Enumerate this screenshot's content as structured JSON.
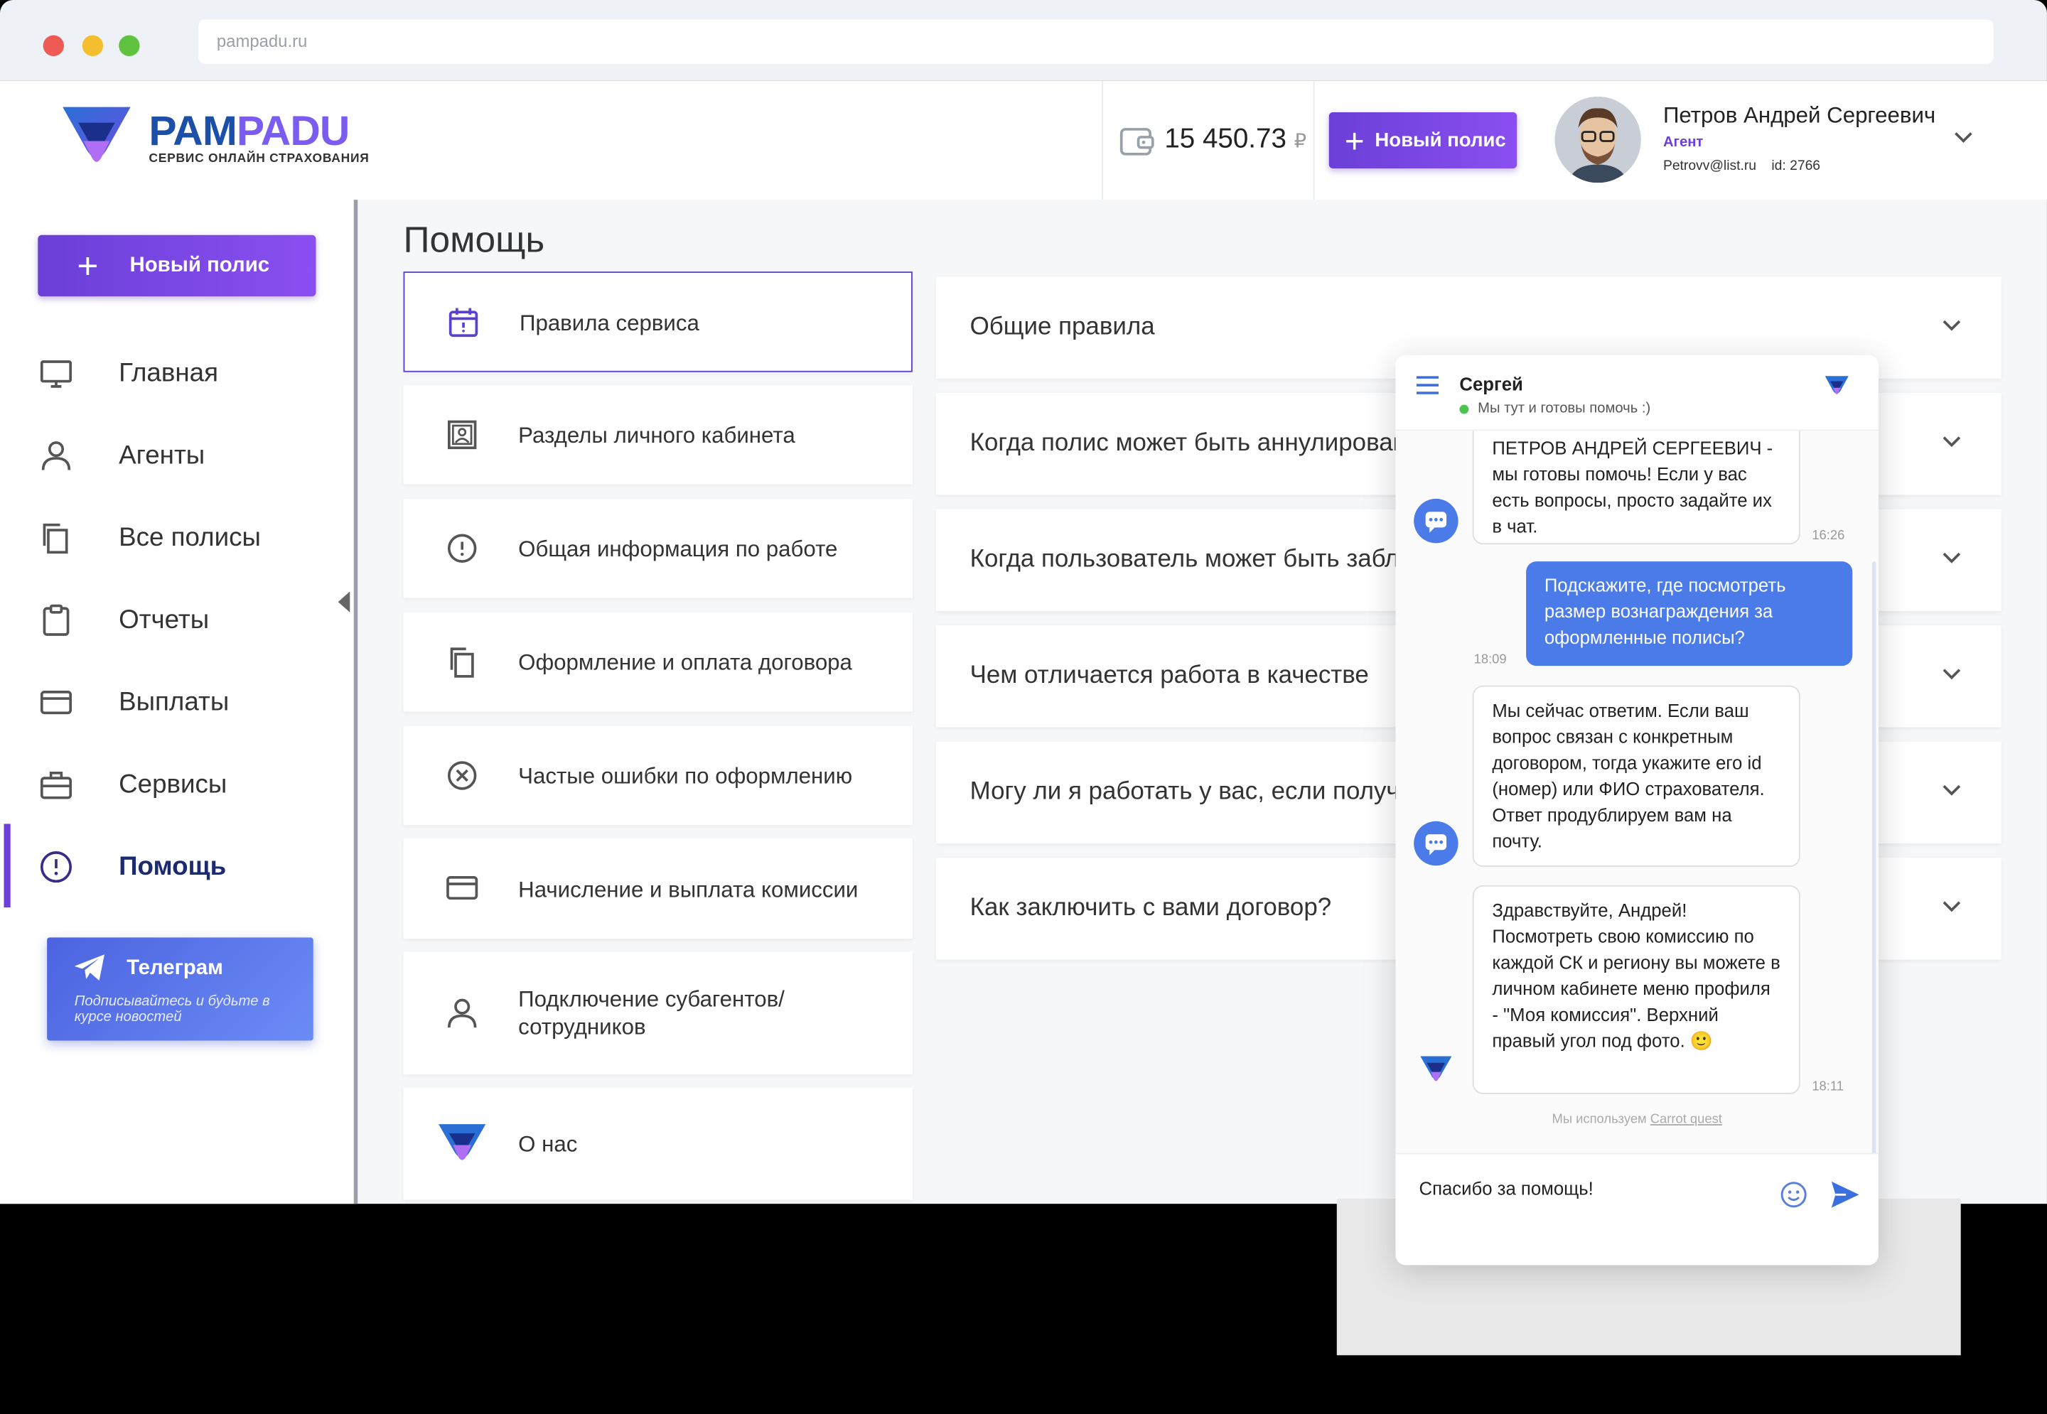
{
  "browser": {
    "url": "pampadu.ru"
  },
  "header": {
    "logo_main_a": "PAM",
    "logo_main_b": "PADU",
    "logo_sub": "СЕРВИС ОНЛАЙН СТРАХОВАНИЯ",
    "balance": "15 450.73",
    "currency": "₽",
    "new_policy_label": "Новый полис",
    "user_name": "Петров Андрей Сергеевич",
    "user_role": "Агент",
    "user_email": "Petrovv@list.ru",
    "user_id": "id: 2766"
  },
  "sidebar": {
    "new_policy_label": "Новый полис",
    "items": [
      {
        "label": "Главная",
        "icon": "monitor-icon"
      },
      {
        "label": "Агенты",
        "icon": "user-icon"
      },
      {
        "label": "Все полисы",
        "icon": "copy-icon"
      },
      {
        "label": "Отчеты",
        "icon": "clipboard-icon"
      },
      {
        "label": "Выплаты",
        "icon": "card-icon"
      },
      {
        "label": "Сервисы",
        "icon": "briefcase-icon"
      },
      {
        "label": "Помощь",
        "icon": "alert-circle-icon",
        "active": true
      }
    ],
    "telegram": {
      "title": "Телеграм",
      "subtitle": "Подписывайтесь и будьте в курсе новостей"
    }
  },
  "main": {
    "title": "Помощь",
    "topics": [
      {
        "label": "Правила сервиса",
        "icon": "calendar-icon",
        "selected": true
      },
      {
        "label": "Разделы личного кабинета",
        "icon": "image-icon"
      },
      {
        "label": "Общая информация по работе",
        "icon": "alert-circle-icon"
      },
      {
        "label": "Оформление и оплата договора",
        "icon": "copy-icon"
      },
      {
        "label": "Частые ошибки по оформлению",
        "icon": "x-circle-icon"
      },
      {
        "label": "Начисление и выплата комиссии",
        "icon": "card-icon"
      },
      {
        "label": "Подключение субагентов/ сотрудников",
        "icon": "user-icon"
      },
      {
        "label": "О нас",
        "icon": "pampadu-logo-icon"
      }
    ],
    "questions": [
      "Общие правила",
      "Когда полис может быть аннулирован",
      "Когда пользователь может быть заблокирован",
      "Чем отличается работа в качестве",
      "Могу ли я работать у вас, если получу",
      "Как заключить с вами договор?"
    ]
  },
  "chat": {
    "agent_name": "Сергей",
    "status": "Мы тут и готовы помочь :)",
    "messages": [
      {
        "from": "bot",
        "text": "ПЕТРОВ АНДРЕЙ СЕРГЕЕВИЧ - мы готовы помочь! Если у вас есть вопросы, просто задайте их в чат.",
        "time": "16:26"
      },
      {
        "from": "user",
        "text": "Подскажите, где посмотреть размер вознаграждения за оформленные полисы?",
        "time": "18:09"
      },
      {
        "from": "bot",
        "text": "Мы сейчас ответим. Если ваш вопрос связан с конкретным договором, тогда укажите его id (номер) или ФИО страхователя. Ответ продублируем вам на почту.",
        "time": ""
      },
      {
        "from": "operator",
        "text": "Здравствуйте, Андрей! Посмотреть свою комиссию по каждой СК и региону вы можете в личном кабинете меню профиля - \"Моя комиссия\". Верхний правый угол под фото. 🙂",
        "time": "18:11"
      }
    ],
    "powered_prefix": "Мы используем",
    "powered_link": "Carrot quest",
    "input_value": "Спасибо за помощь!"
  }
}
